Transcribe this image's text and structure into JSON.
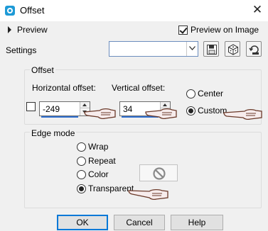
{
  "window": {
    "title": "Offset",
    "icon": "app-logo-icon",
    "close_icon": "close-icon"
  },
  "preview": {
    "label": "Preview",
    "preview_on_image_label": "Preview on Image",
    "preview_on_image_checked": true
  },
  "settings": {
    "label": "Settings",
    "value": "",
    "icons": [
      "save-preset-icon",
      "randomize-icon",
      "reset-icon"
    ]
  },
  "offset": {
    "title": "Offset",
    "horizontal_label": "Horizontal offset:",
    "horizontal_value": "-249",
    "vertical_label": "Vertical offset:",
    "vertical_value": "34",
    "link_checked": false,
    "center_label": "Center",
    "custom_label": "Custom",
    "selected": "Custom"
  },
  "edge_mode": {
    "title": "Edge mode",
    "options": [
      "Wrap",
      "Repeat",
      "Color",
      "Transparent"
    ],
    "selected": "Transparent",
    "color_icon": "no-color-icon"
  },
  "buttons": {
    "ok": "OK",
    "cancel": "Cancel",
    "help": "Help"
  },
  "colors": {
    "accent": "#0078d7",
    "titlebar": "#ffffff",
    "dialog_bg": "#f0f0f0",
    "spin_underline": "#2f6fcf",
    "hand_pointer": "#6b3a2a"
  }
}
